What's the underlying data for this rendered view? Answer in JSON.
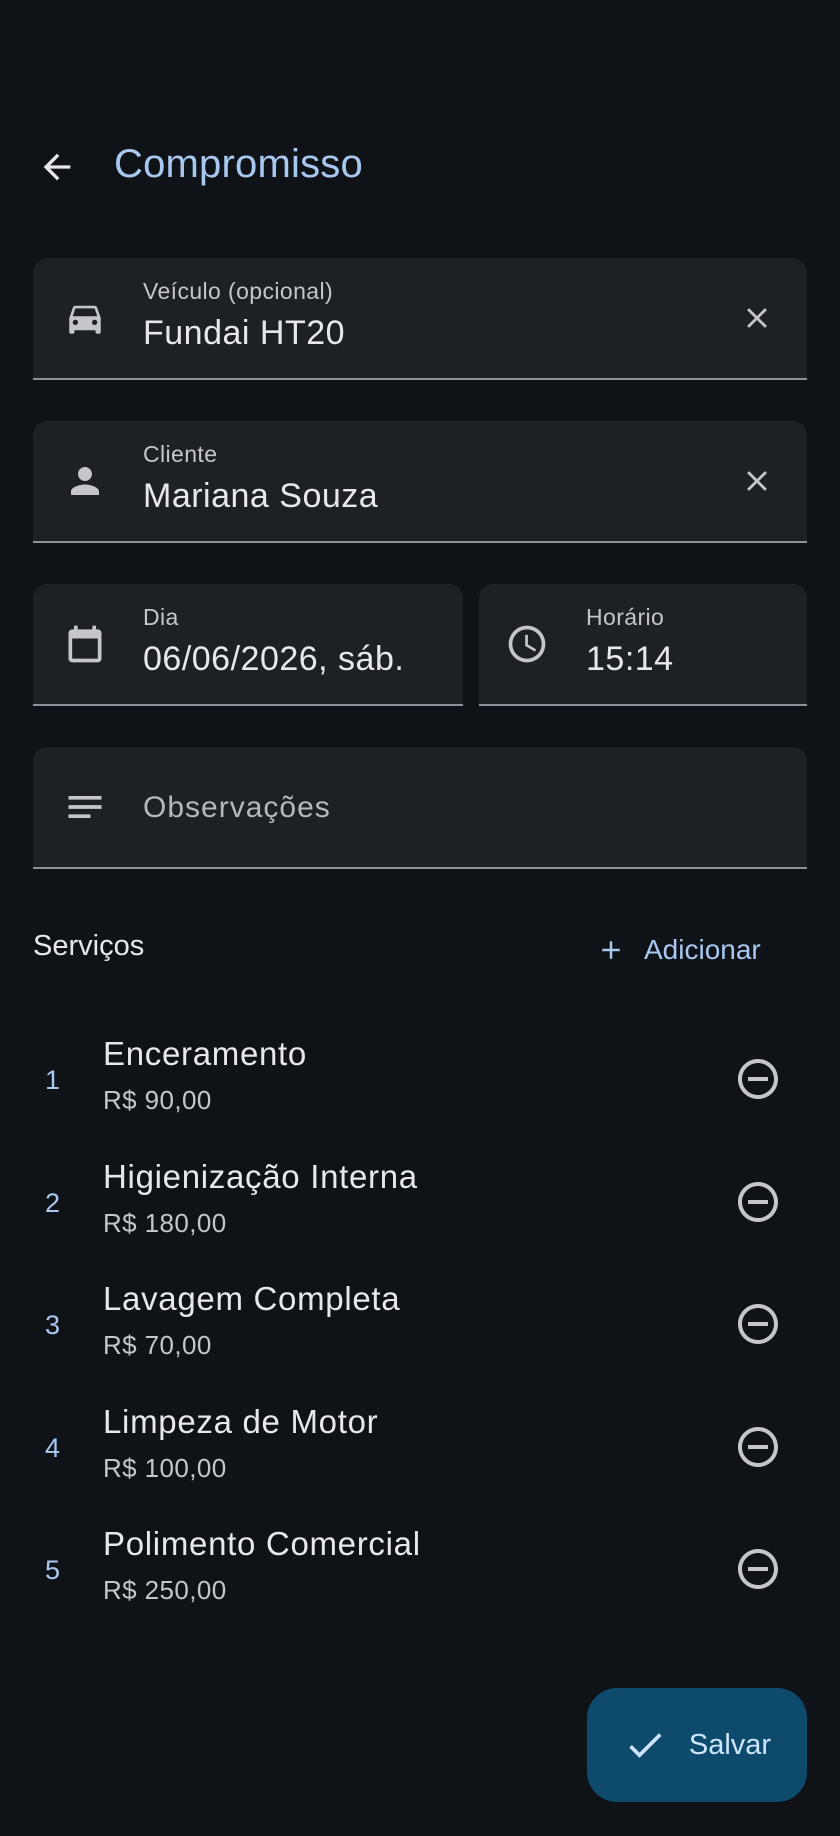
{
  "appbar": {
    "title": "Compromisso",
    "back_icon": "arrow-left-icon"
  },
  "form": {
    "vehicle": {
      "label": "Veículo (opcional)",
      "value": "Fundai HT20",
      "icon": "car-icon"
    },
    "client": {
      "label": "Cliente",
      "value": "Mariana Souza",
      "icon": "person-icon"
    },
    "date": {
      "label": "Dia",
      "value": "06/06/2026, sáb.",
      "icon": "calendar-icon"
    },
    "time": {
      "label": "Horário",
      "value": "15:14",
      "icon": "clock-icon"
    },
    "notes": {
      "placeholder": "Observações",
      "icon": "notes-icon"
    }
  },
  "services": {
    "title": "Serviços",
    "add_label": "Adicionar",
    "items": [
      {
        "index": "1",
        "name": "Enceramento",
        "price": "R$ 90,00"
      },
      {
        "index": "2",
        "name": "Higienização Interna",
        "price": "R$ 180,00"
      },
      {
        "index": "3",
        "name": "Lavagem Completa",
        "price": "R$ 70,00"
      },
      {
        "index": "4",
        "name": "Limpeza de Motor",
        "price": "R$ 100,00"
      },
      {
        "index": "5",
        "name": "Polimento Comercial",
        "price": "R$ 250,00"
      }
    ]
  },
  "fab": {
    "label": "Salvar",
    "icon": "check-icon"
  },
  "colors": {
    "background": "#0f1318",
    "field_bg": "#1d2126",
    "accent": "#a8c8f0",
    "fab_bg": "#0d4a6c"
  }
}
